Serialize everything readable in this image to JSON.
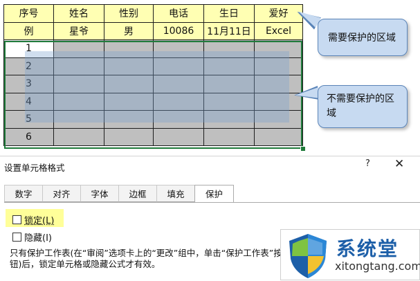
{
  "sheet": {
    "headers": [
      "序号",
      "姓名",
      "性别",
      "电话",
      "生日",
      "爱好"
    ],
    "example_row": [
      "例",
      "星爷",
      "男",
      "10086",
      "11月11日",
      "Excel"
    ],
    "row_numbers": [
      "1",
      "2",
      "3",
      "4",
      "5",
      "6"
    ]
  },
  "callouts": {
    "protect": "需要保护的区域",
    "no_protect": "不需要保护的区域"
  },
  "dialog": {
    "title": "设置单元格格式",
    "help": "?",
    "close": "✕",
    "tabs": [
      "数字",
      "对齐",
      "字体",
      "边框",
      "填充",
      "保护"
    ],
    "active_tab": "保护",
    "lock_label": "锁定(L)",
    "hide_label": "隐藏(I)",
    "description": "只有保护工作表(在“审阅”选项卡上的“更改”组中，单击“保护工作表”按钮)后，锁定单元格或隐藏公式才有效。"
  },
  "watermark": {
    "cn": "系统堂",
    "en": "xitongtang.com"
  },
  "colors": {
    "header_fill": "#ffffb3",
    "gray_fill": "#bfbfbf",
    "selection": "#1f7a3a",
    "callout_fill": "#c7daf1",
    "logo_blue": "#1d5fa8"
  }
}
